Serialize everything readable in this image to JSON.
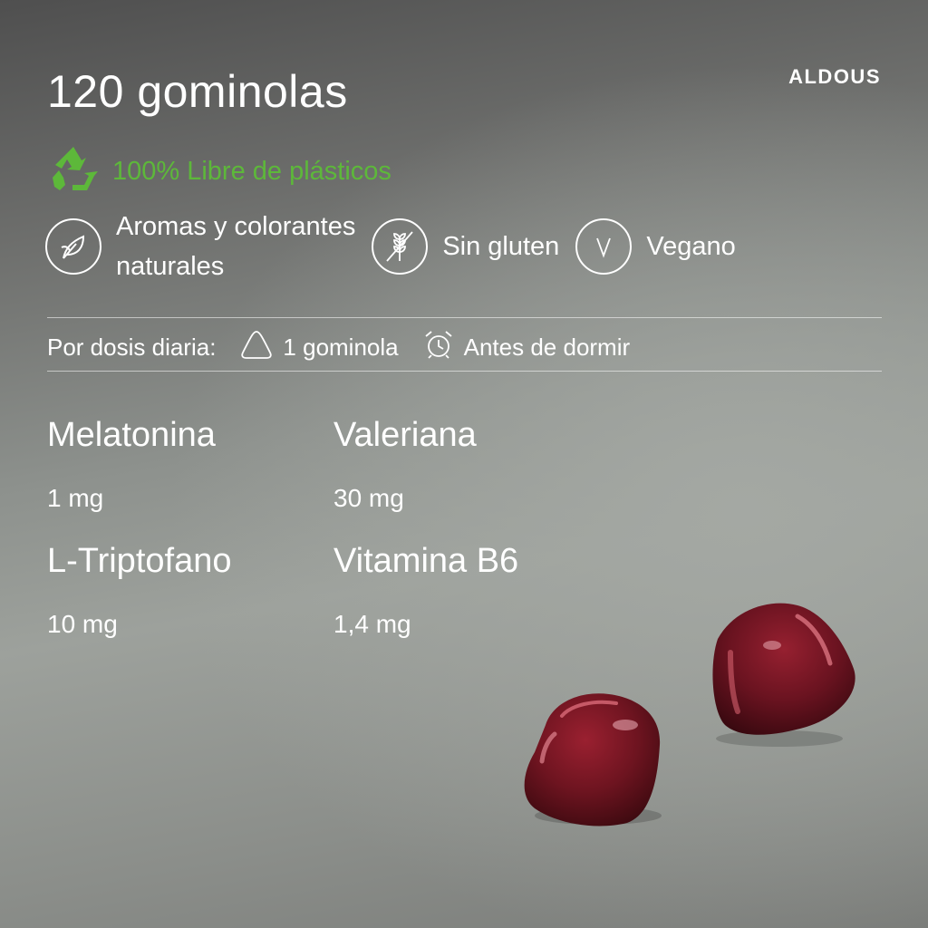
{
  "header": {
    "title": "120 gominolas",
    "brand": "ALDOUS"
  },
  "eco": {
    "text": "100% Libre de plásticos",
    "color": "#5db83a"
  },
  "features": [
    {
      "label": "Aromas y colorantes naturales",
      "line1": "Aromas y colorantes",
      "line2": "naturales",
      "icon": "leaf-icon"
    },
    {
      "label": "Sin gluten",
      "icon": "gluten-free-wheat-icon"
    },
    {
      "label": "Vegano",
      "icon": "vegan-v-icon"
    }
  ],
  "dose": {
    "label": "Por dosis diaria:",
    "quantity": "1 gominola",
    "timing": "Antes de dormir"
  },
  "ingredients": [
    {
      "name": "Melatonina",
      "amount": "1 mg"
    },
    {
      "name": "Valeriana",
      "amount": "30 mg"
    },
    {
      "name": "L-Triptofano",
      "amount": "10 mg"
    },
    {
      "name": "Vitamina B6",
      "amount": "1,4 mg"
    }
  ],
  "colors": {
    "gummy": "#7a1520",
    "text": "#ffffff",
    "accent_green": "#5db83a"
  }
}
